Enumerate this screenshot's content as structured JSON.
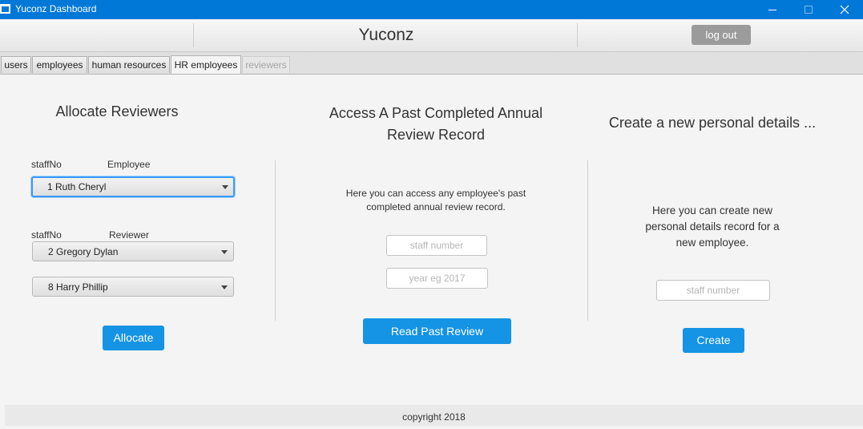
{
  "window": {
    "title": "Yuconz Dashboard"
  },
  "header": {
    "brand": "Yuconz",
    "logout_label": "log out"
  },
  "tabs": [
    {
      "label": "users"
    },
    {
      "label": "employees"
    },
    {
      "label": "human resources"
    },
    {
      "label": "HR employees",
      "active": true
    },
    {
      "label": "reviewers",
      "disabled": true
    }
  ],
  "allocate": {
    "heading": "Allocate Reviewers",
    "employee_col_staff": "staffNo",
    "employee_col_name": "Employee",
    "employee_selected": "1  Ruth Cheryl",
    "reviewer_col_staff": "staffNo",
    "reviewer_col_name": "Reviewer",
    "reviewer1_selected": "2  Gregory Dylan",
    "reviewer2_selected": "8  Harry Phillip",
    "button_label": "Allocate"
  },
  "past_review": {
    "heading_line1": "Access A Past Completed Annual",
    "heading_line2": "Review Record",
    "desc_line1": "Here you can access any employee's past",
    "desc_line2": "completed annual review record.",
    "staff_placeholder": "staff number",
    "year_placeholder": "year eg 2017",
    "button_label": "Read Past Review"
  },
  "create_details": {
    "heading": "Create a new personal details ...",
    "desc_line1": "Here you can create new",
    "desc_line2": "personal details record for a",
    "desc_line3": "new employee.",
    "staff_placeholder": "staff number",
    "button_label": "Create"
  },
  "footer": {
    "text": "copyright 2018"
  },
  "colors": {
    "titlebar": "#0078d7",
    "accent": "#1593e4",
    "logout": "#9b9b9b",
    "focus": "#3b99fc"
  },
  "icons": [
    "app-window-icon",
    "minimize-icon",
    "maximize-icon",
    "close-icon",
    "chevron-down-icon"
  ]
}
